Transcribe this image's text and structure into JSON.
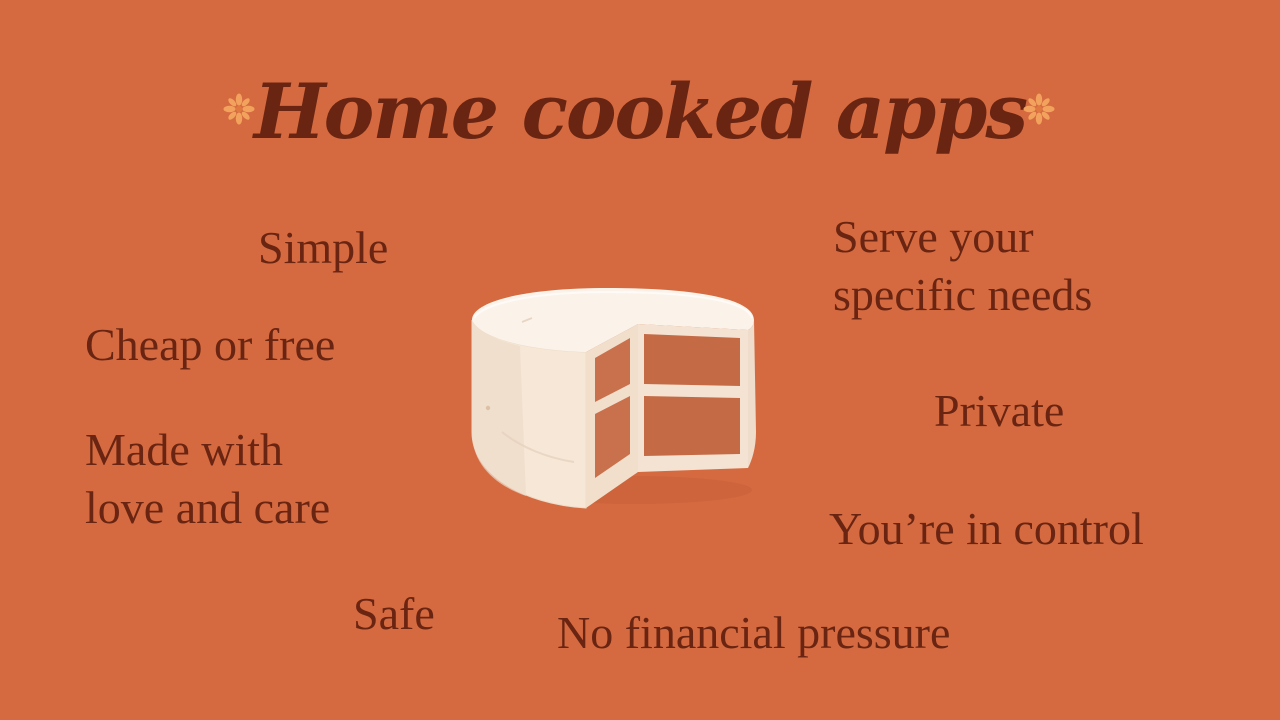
{
  "slide": {
    "title": "Home cooked apps",
    "background_color": "#D56A40",
    "text_color": "#6A2512",
    "accent_color": "#F2A25C",
    "decorations": {
      "left_icon": "asterisk-flower-icon",
      "right_icon": "asterisk-flower-icon"
    },
    "illustration": "cake-slice-illustration",
    "left_items": {
      "simple": "Simple",
      "cheap": "Cheap or free",
      "love_line1": "Made with",
      "love_line2": "love and care",
      "safe": "Safe"
    },
    "right_items": {
      "serve_line1": "Serve your",
      "serve_line2": "specific needs",
      "private": "Private",
      "control": "You’re in control",
      "pressure": "No financial pressure"
    }
  }
}
